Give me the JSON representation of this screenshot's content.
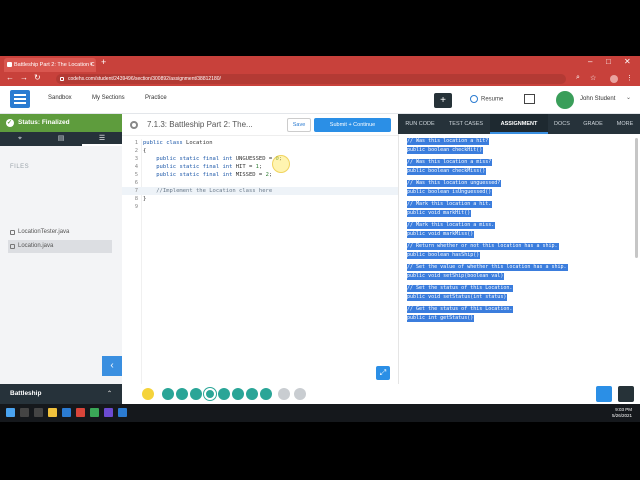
{
  "browser": {
    "tab_title": "Battleship Part 2: The Location C",
    "tab_close": "×",
    "new_tab": "+",
    "window_controls": [
      "–",
      "□",
      "✕"
    ],
    "url": "codehs.com/student/2439496/section/300892/assignment/38812180/",
    "nav": [
      "←",
      "→",
      "↻"
    ]
  },
  "header": {
    "nav": [
      "Sandbox",
      "My Sections",
      "Practice"
    ],
    "plus_label": "+",
    "resume_label": "Resume",
    "user_name": "John Student",
    "chevron": "⌄"
  },
  "left": {
    "status": "Status: Finalized",
    "files_heading": "FILES",
    "files": [
      "LocationTester.java",
      "Location.java"
    ],
    "bottom_title": "Battleship",
    "collapse_label": "‹",
    "up_label": "⌃"
  },
  "editor": {
    "title": "7.1.3: Battleship Part 2: The...",
    "save_label": "Save",
    "submit_label": "Submit + Continue",
    "expand_label": "⤢",
    "lines": [
      {
        "n": "1",
        "t": "public class Location"
      },
      {
        "n": "2",
        "t": "{"
      },
      {
        "n": "3",
        "t": "    public static final int UNGUESSED = 0;"
      },
      {
        "n": "4",
        "t": "    public static final int HIT = 1;"
      },
      {
        "n": "5",
        "t": "    public static final int MISSED = 2;"
      },
      {
        "n": "6",
        "t": ""
      },
      {
        "n": "7",
        "t": "    //Implement the Location class here"
      },
      {
        "n": "8",
        "t": "}"
      },
      {
        "n": "9",
        "t": ""
      }
    ]
  },
  "right": {
    "tabs": [
      "RUN CODE",
      "TEST CASES",
      "ASSIGNMENT",
      "DOCS",
      "GRADE",
      "MORE"
    ],
    "active_tab": "ASSIGNMENT",
    "assignment_lines": [
      "// Was this location a hit?",
      "public boolean checkHit()",
      "",
      "// Was this location a miss?",
      "public boolean checkMiss()",
      "",
      "// Was this location unguessed?",
      "public boolean isUnguessed()",
      "",
      "// Mark this location a hit.",
      "public void markHit()",
      "",
      "// Mark this location a miss.",
      "public void markMiss()",
      "",
      "// Return whether or not this location has a ship.",
      "public boolean hasShip()",
      "",
      "// Set the value of whether this location has a ship.",
      "public void setShip(boolean val)",
      "",
      "// Set the status of this Location.",
      "public void setStatus(int status)",
      "",
      "// Get the status of this Location.",
      "public int getStatus()"
    ]
  },
  "taskbar": {
    "time": "9:03 PM",
    "date": "5/26/2021"
  },
  "colors": {
    "chrome": "#c8413b",
    "status_green": "#5e9c3d",
    "accent_blue": "#2b8fe6",
    "dark_nav": "#26323a",
    "selection": "#3b7ddd"
  }
}
